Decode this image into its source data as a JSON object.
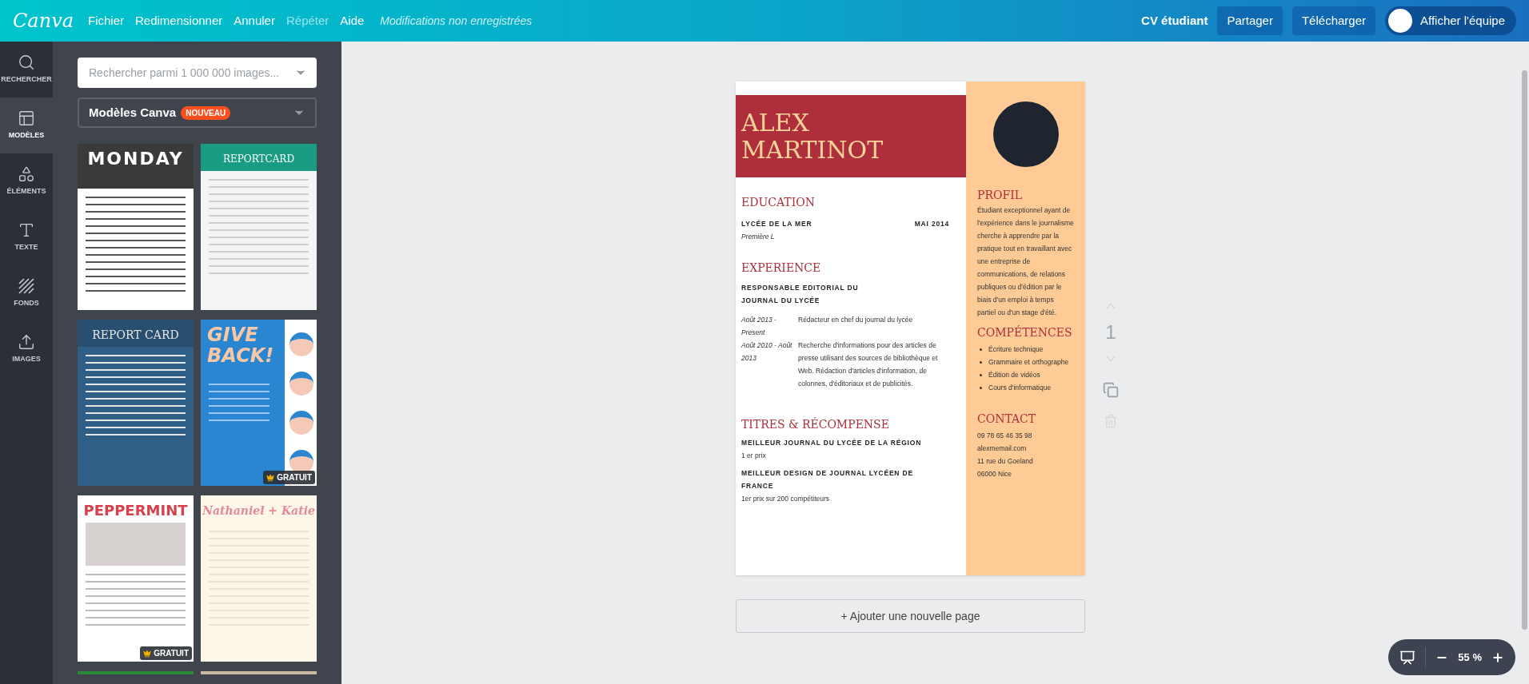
{
  "topbar": {
    "logo": "Canva",
    "menu": [
      {
        "label": "Fichier",
        "disabled": false
      },
      {
        "label": "Redimensionner",
        "disabled": false
      },
      {
        "label": "Annuler",
        "disabled": false
      },
      {
        "label": "Répéter",
        "disabled": true
      },
      {
        "label": "Aide",
        "disabled": false
      }
    ],
    "status": "Modifications non enregistrées",
    "doc_title": "CV étudiant",
    "buttons": [
      "Partager",
      "Télécharger"
    ],
    "team_toggle": {
      "label": "Afficher l'équipe",
      "on": false
    }
  },
  "sidebar": {
    "items": [
      {
        "kind": "search",
        "label": "RECHERCHER",
        "selected": false
      },
      {
        "kind": "templates",
        "label": "MODÈLES",
        "selected": true
      },
      {
        "kind": "elements",
        "label": "ÉLÉMENTS",
        "selected": false
      },
      {
        "kind": "text",
        "label": "TEXTE",
        "selected": false
      },
      {
        "kind": "backgrounds",
        "label": "FONDS",
        "selected": false
      },
      {
        "kind": "uploads",
        "label": "IMAGES",
        "selected": false
      }
    ]
  },
  "panel": {
    "search": {
      "placeholder": "Rechercher parmi 1 000 000 images..."
    },
    "category": {
      "label": "Modèles Canva",
      "badge": "NOUVEAU"
    },
    "templates": [
      {
        "kind": "planner",
        "title": "MONDAY"
      },
      {
        "kind": "report_green",
        "title": "REPORTCARD"
      },
      {
        "kind": "report_blue",
        "title": "REPORT CARD"
      },
      {
        "kind": "poster",
        "title": "GIVE BACK!",
        "badge": "GRATUIT"
      },
      {
        "kind": "newsletter",
        "title": "PEPPERMINT",
        "badge": "GRATUIT"
      },
      {
        "kind": "wedding",
        "title": "Nathaniel + Katie"
      }
    ]
  },
  "resume": {
    "name": [
      "ALEX",
      "MARTINOT"
    ],
    "education": {
      "heading": "EDUCATION",
      "school": "LYCÉE DE LA MER",
      "date": "MAI 2014",
      "detail": "Première L"
    },
    "experience": {
      "heading": "EXPERIENCE",
      "role": "RESPONSABLE EDITORIAL DU JOURNAL DU LYCÉE",
      "entries": [
        {
          "dates": "Août 2013 - Present",
          "text": "Rédacteur en chef du journal du lycée"
        },
        {
          "dates": "Août 2010 - Août 2013",
          "text": "Recherche d'informations pour des articles de presse utilisant des sources de bibliothèque et Web. Rédaction d'articles d'information, de colonnes, d'éditoriaux et de publicités."
        }
      ]
    },
    "awards": {
      "heading": "TITRES & RÉCOMPENSE",
      "items": [
        {
          "title": "MEILLEUR JOURNAL DU LYCÉE DE LA RÉGION",
          "detail": "1 er prix"
        },
        {
          "title": "MEILLEUR DESIGN DE JOURNAL LYCÉEN DE FRANCE",
          "detail": "1er prix sur 200 compétiteurs"
        }
      ]
    },
    "profile": {
      "heading": "PROFIL",
      "text": "Étudiant exceptionnel ayant de l'expérience dans le journalisme  cherche à apprendre par la pratique tout en travaillant avec une entreprise de communications, de relations publiques ou d'édition par le biais d'un emploi à temps partiel ou d'un stage d'été."
    },
    "skills": {
      "heading": "COMPÉTENCES",
      "items": [
        "Écriture technique",
        "Grammaire et orthographe",
        "Édition de vidéos",
        "Cours d'informatique"
      ]
    },
    "contact": {
      "heading": "CONTACT",
      "lines": [
        "09 78 65 46 35 98",
        "alexmemail.com",
        "11 rue du Goeland",
        "06000 Nice"
      ]
    }
  },
  "page_controls": {
    "page_number": "1"
  },
  "add_page": "+ Ajouter une nouvelle page",
  "zoom": {
    "value": "55 %"
  }
}
